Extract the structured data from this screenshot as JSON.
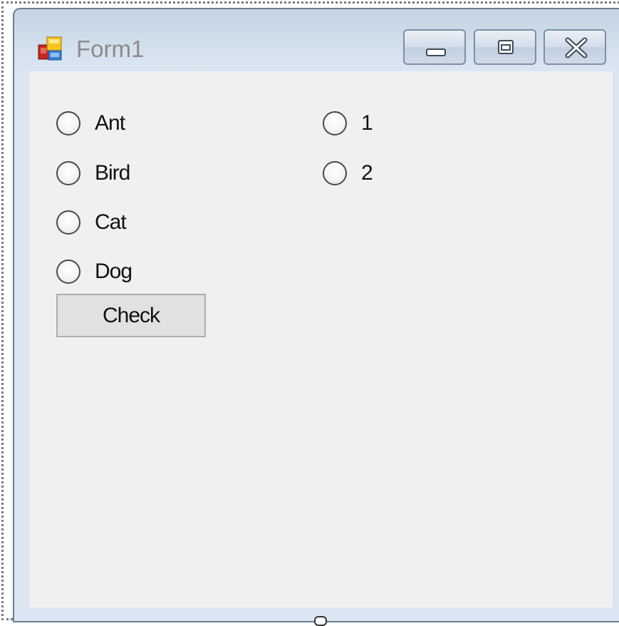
{
  "window": {
    "title": "Form1",
    "minimize_icon": "minimize-icon",
    "maximize_icon": "maximize-icon",
    "close_icon": "close-icon"
  },
  "animals": [
    {
      "label": "Ant",
      "checked": false
    },
    {
      "label": "Bird",
      "checked": false
    },
    {
      "label": "Cat",
      "checked": false
    },
    {
      "label": "Dog",
      "checked": false
    }
  ],
  "numbers": [
    {
      "label": "1",
      "checked": false
    },
    {
      "label": "2",
      "checked": false
    }
  ],
  "check_button": {
    "label": "Check"
  },
  "colors": {
    "client_background": "#f0f0f0",
    "frame_background": "#dbe6f2",
    "title_text": "#8c8c8c"
  }
}
